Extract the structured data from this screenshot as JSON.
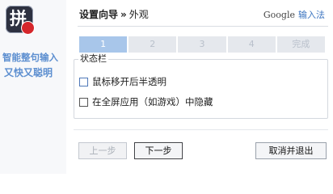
{
  "sidebar": {
    "logo_glyph": "拼",
    "slogan_line1": "智能整句输入",
    "slogan_line2": "又快又聪明"
  },
  "header": {
    "title": "设置向导",
    "separator": "»",
    "current_page": "外观",
    "brand_google": "Google",
    "brand_ime": "输入法"
  },
  "steps": [
    {
      "label": "1",
      "active": true
    },
    {
      "label": "2",
      "active": false
    },
    {
      "label": "3",
      "active": false
    },
    {
      "label": "4",
      "active": false
    },
    {
      "label": "完成",
      "active": false
    }
  ],
  "group": {
    "legend": "状态栏",
    "options": [
      {
        "label": "鼠标移开后半透明",
        "checked": false
      },
      {
        "label": "在全屏应用（如游戏）中隐藏",
        "checked": false
      }
    ]
  },
  "buttons": {
    "prev": "上一步",
    "next": "下一步",
    "cancel": "取消并退出"
  },
  "colors": {
    "accent": "#5d8fd0",
    "step_active": "#a8c6ea",
    "step_inactive": "#e5e8ed",
    "logo_badge": "#d5262b"
  }
}
